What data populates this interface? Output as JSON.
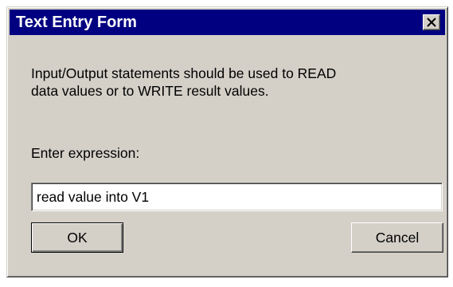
{
  "window": {
    "title": "Text Entry Form",
    "close_icon": "close-icon"
  },
  "message": {
    "line1": "Input/Output statements should be used to READ",
    "line2": "data values or to WRITE result values."
  },
  "entry": {
    "label": "Enter expression:",
    "value": "read value into V1"
  },
  "buttons": {
    "ok": "OK",
    "cancel": "Cancel"
  },
  "colors": {
    "titlebar": "#000080",
    "face": "#d4d0c8"
  }
}
